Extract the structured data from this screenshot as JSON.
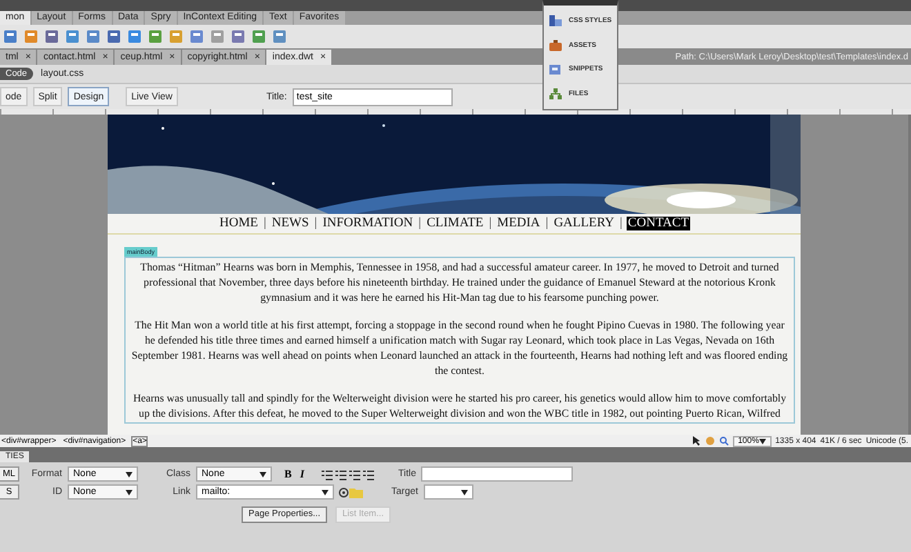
{
  "insert_tabs": [
    {
      "label": "mon",
      "selected": true
    },
    {
      "label": "Layout",
      "selected": false
    },
    {
      "label": "Forms",
      "selected": false
    },
    {
      "label": "Data",
      "selected": false
    },
    {
      "label": "Spry",
      "selected": false
    },
    {
      "label": "InContext Editing",
      "selected": false
    },
    {
      "label": "Text",
      "selected": false
    },
    {
      "label": "Favorites",
      "selected": false
    }
  ],
  "doc_tabs": [
    {
      "label": "tml",
      "selected": false
    },
    {
      "label": "contact.html",
      "selected": false
    },
    {
      "label": "ceup.html",
      "selected": false
    },
    {
      "label": "copyright.html",
      "selected": false
    },
    {
      "label": "index.dwt",
      "selected": true
    }
  ],
  "close_glyph": "×",
  "path": "Path:  C:\\Users\\Mark Leroy\\Desktop\\test\\Templates\\index.d",
  "related_files": {
    "source": "Code",
    "files": [
      "layout.css"
    ]
  },
  "doc_toolbar": {
    "views": [
      {
        "label": "ode",
        "selected": false
      },
      {
        "label": "Split",
        "selected": false
      },
      {
        "label": "Design",
        "selected": true
      }
    ],
    "live_view": "Live View",
    "title_label": "Title:",
    "title_value": "test_site"
  },
  "page": {
    "nav": {
      "separator": "|",
      "items": [
        {
          "label": "HOME",
          "selected": false
        },
        {
          "label": "NEWS",
          "selected": false
        },
        {
          "label": "INFORMATION",
          "selected": false
        },
        {
          "label": "CLIMATE",
          "selected": false
        },
        {
          "label": "MEDIA",
          "selected": false
        },
        {
          "label": "GALLERY",
          "selected": false
        },
        {
          "label": "CONTACT",
          "selected": true
        }
      ]
    },
    "region_label": "mainBody",
    "paragraphs": [
      "Thomas “Hitman” Hearns was born in Memphis, Tennessee in 1958, and had a successful amateur career. In 1977, he moved to Detroit and turned professional that November, three days before his nineteenth birthday. He trained under the guidance of Emanuel Steward at the notorious Kronk gymnasium and it was here he earned his Hit-Man tag due to his fearsome punching power.",
      "The Hit Man won a world title at his first attempt, forcing a stoppage in the second round when he fought Pipino Cuevas in 1980. The following year he defended his title three times and earned himself a unification match with Sugar ray Leonard, which took place in Las Vegas, Nevada on 16th September 1981. Hearns was well ahead on points when Leonard launched an attack in the fourteenth, Hearns had nothing left and was floored ending the contest.",
      "Hearns was unusually tall and spindly for the Welterweight division were he started his pro career, his genetics would allow him to move comfortably up the divisions. After this defeat, he moved to the Super Welterweight division and won the WBC title in 1982, out pointing Puerto Rican, Wilfred"
    ]
  },
  "status_bar": {
    "tags": [
      {
        "label": "<div#wrapper>",
        "selected": false
      },
      {
        "label": "<div#navigation>",
        "selected": false
      },
      {
        "label": "<a>",
        "selected": true
      }
    ],
    "zoom": "100%",
    "size": "1335 x 404",
    "download": "41K / 6 sec",
    "encoding": "Unicode (5."
  },
  "properties": {
    "header": "TIES",
    "left_buttons": [
      "ML",
      "S"
    ],
    "format_label": "Format",
    "format_value": "None",
    "id_label": "ID",
    "id_value": "None",
    "class_label": "Class",
    "class_value": "None",
    "bold": "B",
    "italic": "I",
    "link_label": "Link",
    "link_value": "mailto:",
    "title_label": "Title",
    "target_label": "Target",
    "page_properties": "Page Properties...",
    "list_item": {
      "label": "List Item...",
      "disabled": true
    }
  },
  "panel": {
    "items": [
      {
        "label": "CSS STYLES",
        "kind": "styles"
      },
      {
        "label": "ASSETS",
        "kind": "assets"
      },
      {
        "label": "SNIPPETS",
        "kind": "snippets"
      },
      {
        "label": "FILES",
        "kind": "files"
      }
    ]
  }
}
